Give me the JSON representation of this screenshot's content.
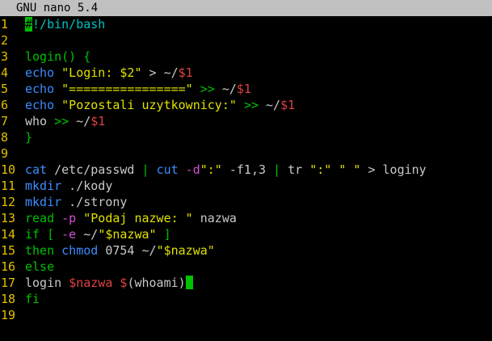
{
  "app": {
    "title": "GNU nano 5.4"
  },
  "colors": {
    "default": "#c8c8c8",
    "keyword": "#00c000",
    "string": "#e0e000",
    "variable": "#e04040",
    "operator": "#00c000",
    "command": "#3c8cff",
    "option": "#d050d0",
    "line_number": "#e0c000"
  },
  "lines": [
    {
      "n": "1",
      "tokens": [
        {
          "t": "#",
          "c": "highlight"
        },
        {
          "t": "!/bin/bash",
          "c": "#00c0c0"
        }
      ]
    },
    {
      "n": "2",
      "tokens": []
    },
    {
      "n": "3",
      "tokens": [
        {
          "t": "login() {",
          "c": "#00c000"
        }
      ]
    },
    {
      "n": "4",
      "tokens": [
        {
          "t": "echo",
          "c": "#3c8cff"
        },
        {
          "t": " ",
          "c": "#c8c8c8"
        },
        {
          "t": "\"Login: $2\"",
          "c": "#e0e000"
        },
        {
          "t": " > ~/",
          "c": "#c8c8c8"
        },
        {
          "t": "$1",
          "c": "#e04040"
        }
      ]
    },
    {
      "n": "5",
      "tokens": [
        {
          "t": "echo",
          "c": "#3c8cff"
        },
        {
          "t": " ",
          "c": "#c8c8c8"
        },
        {
          "t": "\"================\"",
          "c": "#e0e000"
        },
        {
          "t": " ",
          "c": "#c8c8c8"
        },
        {
          "t": ">>",
          "c": "#00c000"
        },
        {
          "t": " ~/",
          "c": "#c8c8c8"
        },
        {
          "t": "$1",
          "c": "#e04040"
        }
      ]
    },
    {
      "n": "6",
      "tokens": [
        {
          "t": "echo",
          "c": "#3c8cff"
        },
        {
          "t": " ",
          "c": "#c8c8c8"
        },
        {
          "t": "\"Pozostali uzytkownicy:\"",
          "c": "#e0e000"
        },
        {
          "t": " ",
          "c": "#c8c8c8"
        },
        {
          "t": ">>",
          "c": "#00c000"
        },
        {
          "t": " ~/",
          "c": "#c8c8c8"
        },
        {
          "t": "$1",
          "c": "#e04040"
        }
      ]
    },
    {
      "n": "7",
      "tokens": [
        {
          "t": "who ",
          "c": "#c8c8c8"
        },
        {
          "t": ">>",
          "c": "#00c000"
        },
        {
          "t": " ~/",
          "c": "#c8c8c8"
        },
        {
          "t": "$1",
          "c": "#e04040"
        }
      ]
    },
    {
      "n": "8",
      "tokens": [
        {
          "t": "}",
          "c": "#00c000"
        }
      ]
    },
    {
      "n": "9",
      "tokens": []
    },
    {
      "n": "10",
      "tokens": [
        {
          "t": "cat",
          "c": "#3c8cff"
        },
        {
          "t": " /etc/passwd ",
          "c": "#c8c8c8"
        },
        {
          "t": "|",
          "c": "#00c000"
        },
        {
          "t": " ",
          "c": "#c8c8c8"
        },
        {
          "t": "cut",
          "c": "#3c8cff"
        },
        {
          "t": " ",
          "c": "#c8c8c8"
        },
        {
          "t": "-d",
          "c": "#d050d0"
        },
        {
          "t": "\":\"",
          "c": "#e0e000"
        },
        {
          "t": " -f1,3 ",
          "c": "#c8c8c8"
        },
        {
          "t": "|",
          "c": "#00c000"
        },
        {
          "t": " tr ",
          "c": "#c8c8c8"
        },
        {
          "t": "\":\" \" \"",
          "c": "#e0e000"
        },
        {
          "t": " > loginy",
          "c": "#c8c8c8"
        }
      ]
    },
    {
      "n": "11",
      "tokens": [
        {
          "t": "mkdir",
          "c": "#3c8cff"
        },
        {
          "t": " ./kody",
          "c": "#c8c8c8"
        }
      ]
    },
    {
      "n": "12",
      "tokens": [
        {
          "t": "mkdir",
          "c": "#3c8cff"
        },
        {
          "t": " ./strony",
          "c": "#c8c8c8"
        }
      ]
    },
    {
      "n": "13",
      "tokens": [
        {
          "t": "read",
          "c": "#00c000"
        },
        {
          "t": " ",
          "c": "#c8c8c8"
        },
        {
          "t": "-p",
          "c": "#d050d0"
        },
        {
          "t": " ",
          "c": "#c8c8c8"
        },
        {
          "t": "\"Podaj nazwe: \"",
          "c": "#e0e000"
        },
        {
          "t": " nazwa",
          "c": "#c8c8c8"
        }
      ]
    },
    {
      "n": "14",
      "tokens": [
        {
          "t": "if [",
          "c": "#00c000"
        },
        {
          "t": " ",
          "c": "#c8c8c8"
        },
        {
          "t": "-e",
          "c": "#d050d0"
        },
        {
          "t": " ~/",
          "c": "#c8c8c8"
        },
        {
          "t": "\"$nazwa\"",
          "c": "#e0e000"
        },
        {
          "t": " ",
          "c": "#c8c8c8"
        },
        {
          "t": "]",
          "c": "#00c000"
        }
      ]
    },
    {
      "n": "15",
      "tokens": [
        {
          "t": "then",
          "c": "#00c000"
        },
        {
          "t": " ",
          "c": "#c8c8c8"
        },
        {
          "t": "chmod",
          "c": "#3c8cff"
        },
        {
          "t": " 0754 ~/",
          "c": "#c8c8c8"
        },
        {
          "t": "\"$nazwa\"",
          "c": "#e0e000"
        }
      ]
    },
    {
      "n": "16",
      "tokens": [
        {
          "t": "else",
          "c": "#00c000"
        }
      ]
    },
    {
      "n": "17",
      "tokens": [
        {
          "t": "login ",
          "c": "#c8c8c8"
        },
        {
          "t": "$nazwa",
          "c": "#e04040"
        },
        {
          "t": " ",
          "c": "#c8c8c8"
        },
        {
          "t": "$",
          "c": "#e04040"
        },
        {
          "t": "(whoami)",
          "c": "#c8c8c8"
        },
        {
          "t": "",
          "c": "cursor"
        }
      ]
    },
    {
      "n": "18",
      "tokens": [
        {
          "t": "fi",
          "c": "#00c000"
        }
      ]
    },
    {
      "n": "19",
      "tokens": []
    }
  ]
}
